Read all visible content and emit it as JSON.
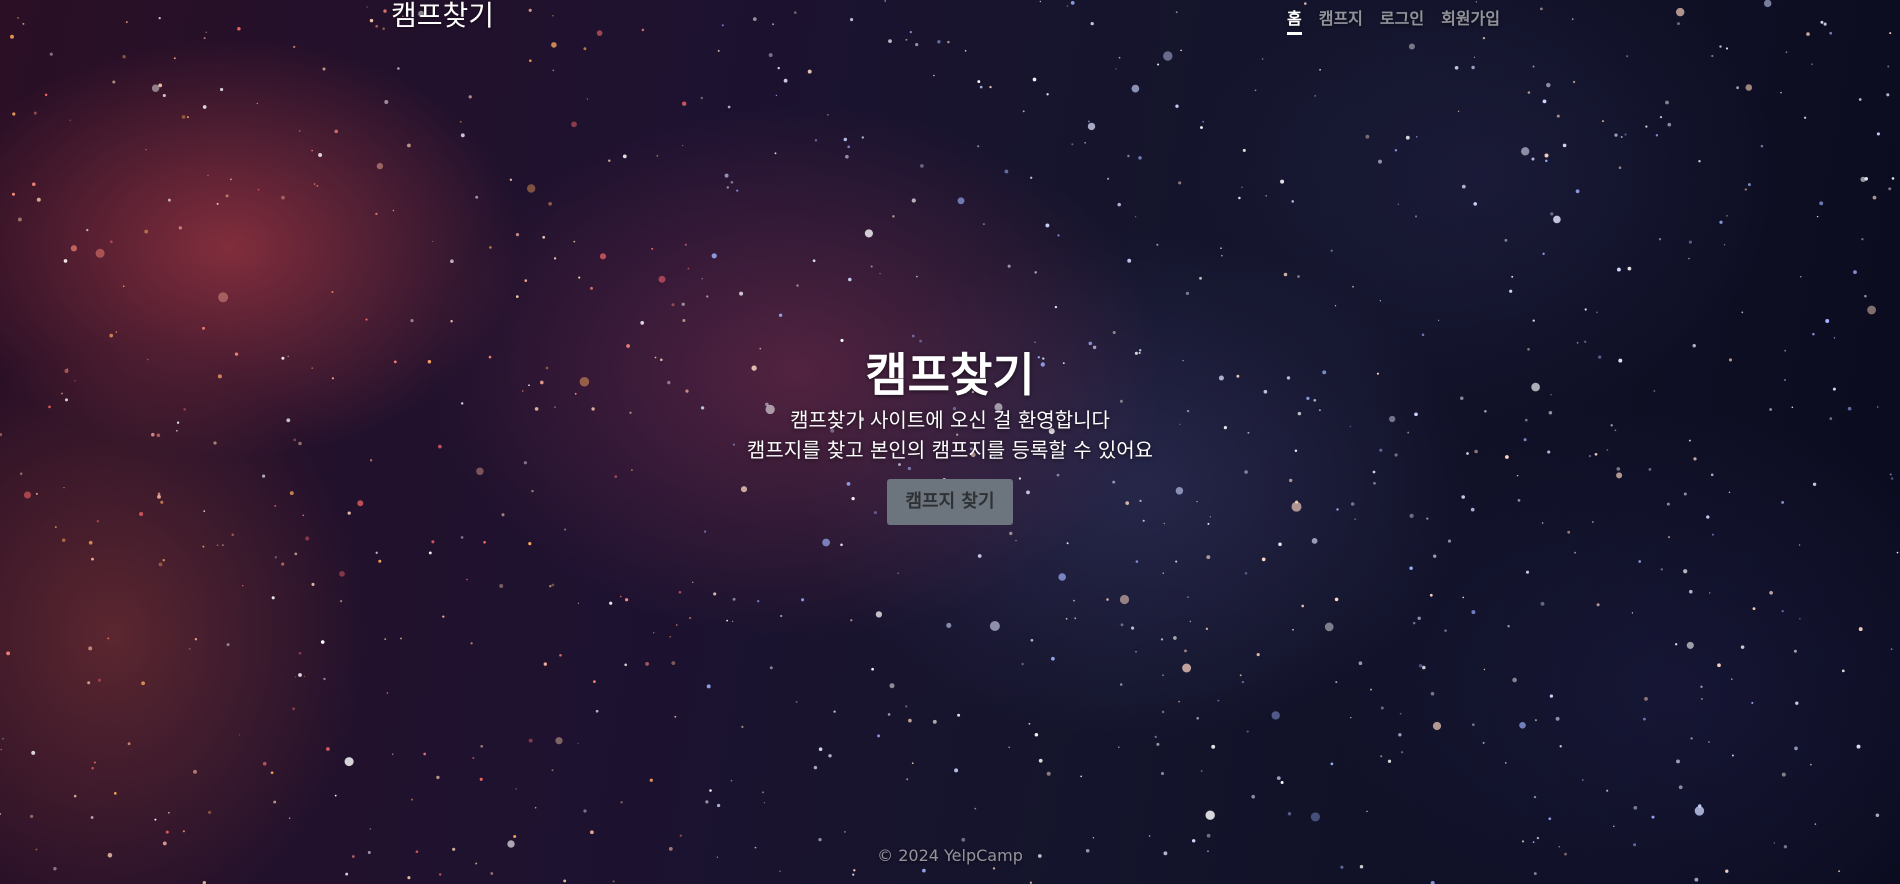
{
  "nav": {
    "brand": "캠프찾기",
    "links": [
      {
        "label": "홈",
        "active": true
      },
      {
        "label": "캠프지",
        "active": false
      },
      {
        "label": "로그인",
        "active": false
      },
      {
        "label": "회원가입",
        "active": false
      }
    ]
  },
  "hero": {
    "title": "캠프찾기",
    "line1": "캠프찾기 사이트에 오신 걸 환영합니다",
    "line2": "캠프지를 찾고 본인의 캠프지를 등록할 수 있어요",
    "button_label": "캠프지 찾기"
  },
  "footer": {
    "text": "© 2024 YelpCamp"
  },
  "colors": {
    "button_bg": "#6c757d",
    "button_text": "#2f3235",
    "text": "#ffffff"
  }
}
